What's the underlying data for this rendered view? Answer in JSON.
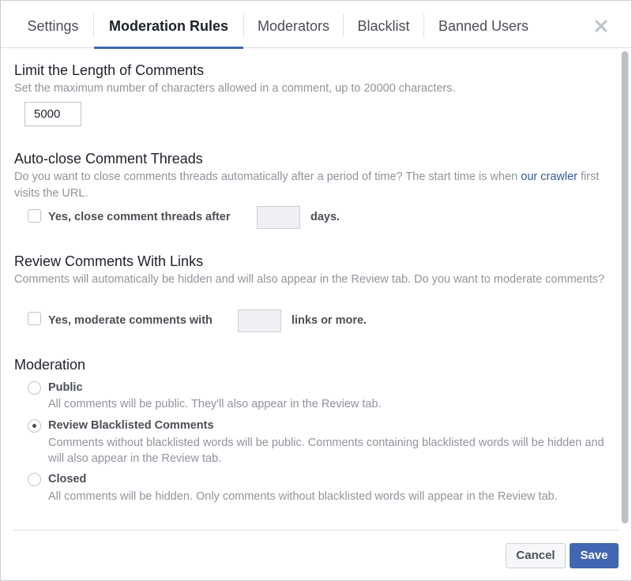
{
  "tabs": [
    {
      "label": "Settings"
    },
    {
      "label": "Moderation Rules",
      "active": true
    },
    {
      "label": "Moderators"
    },
    {
      "label": "Blacklist"
    },
    {
      "label": "Banned Users"
    }
  ],
  "sections": {
    "length": {
      "title": "Limit the Length of Comments",
      "description": "Set the maximum number of characters allowed in a comment, up to 20000 characters.",
      "value": "5000"
    },
    "autoclose": {
      "title": "Auto-close Comment Threads",
      "description_pre": "Do you want to close comments threads automatically after a period of time? The start time is when ",
      "link_text": "our crawler",
      "description_post": " first visits the URL.",
      "checkbox_label": "Yes, close comment threads after",
      "value": "",
      "suffix": "days."
    },
    "links": {
      "title": "Review Comments With Links",
      "description": "Comments will automatically be hidden and will also appear in the Review tab. Do you want to moderate comments?",
      "checkbox_label": "Yes, moderate comments with",
      "value": "",
      "suffix": "links or more."
    },
    "moderation": {
      "title": "Moderation",
      "options": [
        {
          "label": "Public",
          "description": "All comments will be public. They'll also appear in the Review tab.",
          "selected": false
        },
        {
          "label": "Review Blacklisted Comments",
          "description": "Comments without blacklisted words will be public. Comments containing blacklisted words will be hidden and will also appear in the Review tab.",
          "selected": true
        },
        {
          "label": "Closed",
          "description": "All comments will be hidden. Only comments without blacklisted words will appear in the Review tab.",
          "selected": false
        }
      ]
    }
  },
  "footer": {
    "cancel_label": "Cancel",
    "save_label": "Save"
  },
  "colors": {
    "accent": "#4267b2",
    "link": "#365899",
    "muted_text": "#90949c"
  }
}
